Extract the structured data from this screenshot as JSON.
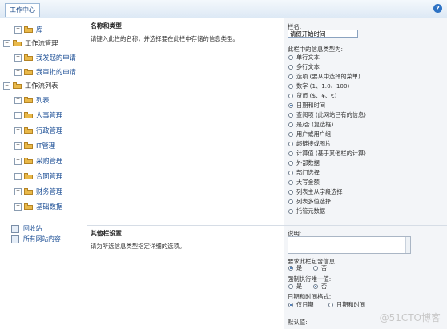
{
  "header": {
    "tab": "工作中心",
    "help_icon": "?"
  },
  "sidebar": {
    "tree": [
      {
        "label": "库",
        "type": "item",
        "level": 0
      },
      {
        "label": "工作流管理",
        "type": "group"
      },
      {
        "label": "我发起的申请",
        "type": "item"
      },
      {
        "label": "我审批的申请",
        "type": "item"
      },
      {
        "label": "工作流列表",
        "type": "group"
      },
      {
        "label": "列表",
        "type": "item"
      },
      {
        "label": "人事管理",
        "type": "item"
      },
      {
        "label": "行政管理",
        "type": "item"
      },
      {
        "label": "IT管理",
        "type": "item"
      },
      {
        "label": "采购管理",
        "type": "item"
      },
      {
        "label": "合同管理",
        "type": "item"
      },
      {
        "label": "财务管理",
        "type": "item"
      },
      {
        "label": "基础数据",
        "type": "item"
      }
    ],
    "bottom_links": [
      "回收站",
      "所有网站内容"
    ]
  },
  "section1": {
    "title": "名称和类型",
    "description": "请键入此栏的名称，并选择要在此栏中存储的信息类型。",
    "name_label": "栏名:",
    "name_value": "请假开始时间",
    "type_label": "此栏中的信息类型为:",
    "types": [
      {
        "label": "单行文本",
        "selected": false
      },
      {
        "label": "多行文本",
        "selected": false
      },
      {
        "label": "选项 (要从中选择的菜单)",
        "selected": false
      },
      {
        "label": "数字 (1、1.0、100)",
        "selected": false
      },
      {
        "label": "货币 ($、¥、€)",
        "selected": false
      },
      {
        "label": "日期和时间",
        "selected": true
      },
      {
        "label": "查阅项 (此网站已有的信息)",
        "selected": false
      },
      {
        "label": "是/否 (复选框)",
        "selected": false
      },
      {
        "label": "用户或用户组",
        "selected": false
      },
      {
        "label": "超链接或图片",
        "selected": false
      },
      {
        "label": "计算值 (基于其他栏的计算)",
        "selected": false
      },
      {
        "label": "外部数据",
        "selected": false
      },
      {
        "label": "部门选择",
        "selected": false
      },
      {
        "label": "大写金额",
        "selected": false
      },
      {
        "label": "列表主从字段选择",
        "selected": false
      },
      {
        "label": "列表多值选择",
        "selected": false
      },
      {
        "label": "托管元数据",
        "selected": false
      }
    ]
  },
  "section2": {
    "title": "其他栏设置",
    "description": "请为所选信息类型指定详细的选项。",
    "desc_label": "说明:",
    "require_label": "要求此栏包含信息:",
    "require_yes": "是",
    "require_no": "否",
    "unique_label": "强制执行唯一值:",
    "unique_yes": "是",
    "unique_no": "否",
    "format_label": "日期和时间格式:",
    "format_date": "仅日期",
    "format_datetime": "日期和时间",
    "default_label": "默认值:"
  },
  "watermark": "@51CTO博客"
}
